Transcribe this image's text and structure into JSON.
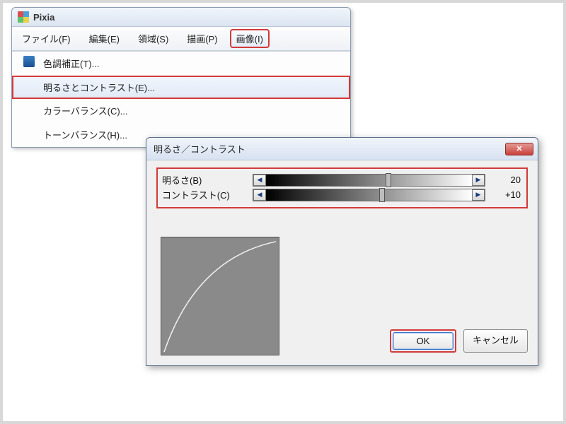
{
  "app": {
    "title": "Pixia"
  },
  "menu": {
    "items": [
      {
        "label": "ファイル(F)"
      },
      {
        "label": "編集(E)"
      },
      {
        "label": "領域(S)"
      },
      {
        "label": "描画(P)"
      },
      {
        "label": "画像(I)"
      }
    ],
    "active_index": 4
  },
  "dropdown": {
    "items": [
      {
        "label": "色調補正(T)..."
      },
      {
        "label": "明るさとコントラスト(E)..."
      },
      {
        "label": "カラーバランス(C)..."
      },
      {
        "label": "トーンバランス(H)..."
      }
    ],
    "highlight_index": 1
  },
  "dialog": {
    "title": "明るさ／コントラスト",
    "brightness_label": "明るさ(B)",
    "contrast_label": "コントラスト(C)",
    "brightness_value": "20",
    "contrast_value": "+10",
    "ok_label": "OK",
    "cancel_label": "キャンセル",
    "close_label": "×"
  }
}
